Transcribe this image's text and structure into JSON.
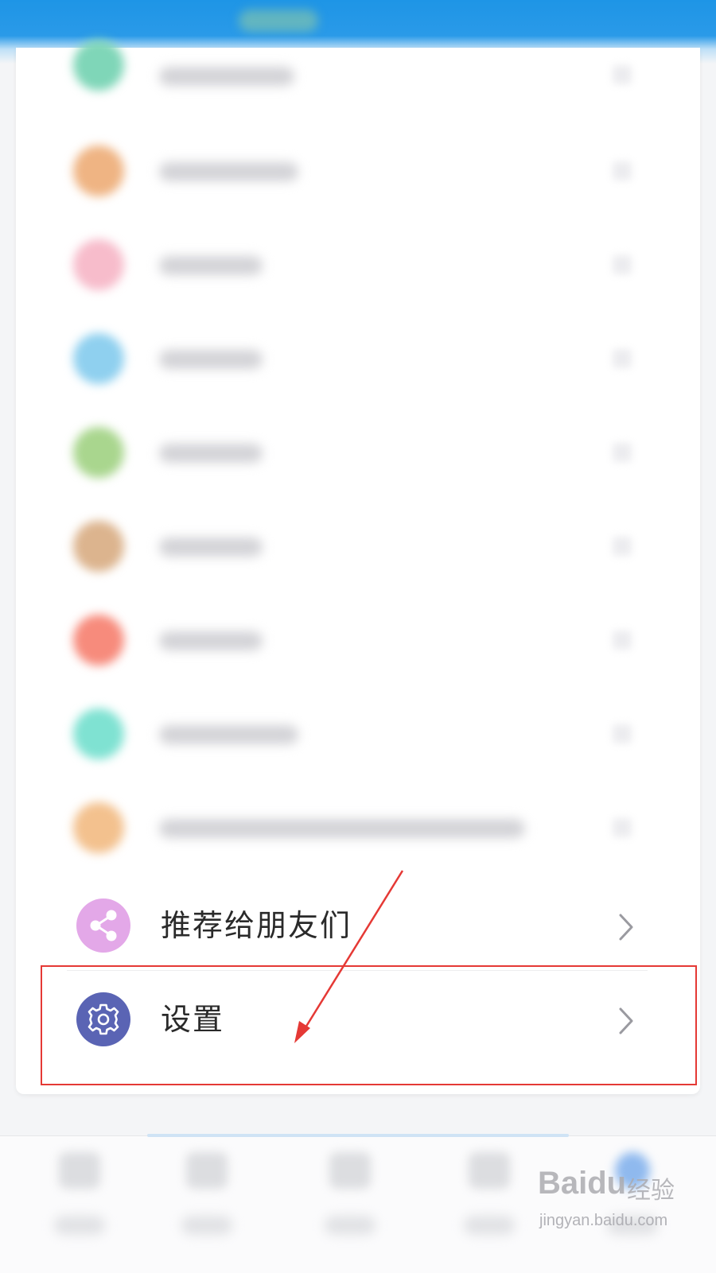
{
  "menu": {
    "blurred_items": [
      {
        "icon_color": "#7fd6b8"
      },
      {
        "icon_color": "#efb483"
      },
      {
        "icon_color": "#f7bccb"
      },
      {
        "icon_color": "#8fd0ef"
      },
      {
        "icon_color": "#a9d68e"
      },
      {
        "icon_color": "#dcb48e"
      },
      {
        "icon_color": "#f78b7c"
      },
      {
        "icon_color": "#7fe2d2"
      },
      {
        "icon_color": "#f3c18e"
      }
    ],
    "items": [
      {
        "label": "推荐给朋友们",
        "icon": "share-icon",
        "icon_color": "#e3a8e8"
      },
      {
        "label": "设置",
        "icon": "gear-icon",
        "icon_color": "#5a64b4"
      }
    ]
  },
  "annotation": {
    "color": "#e53935",
    "target": "设置"
  },
  "bottom_nav": {
    "item_count": 5,
    "active_index": 4
  },
  "watermark": {
    "brand": "Baidu",
    "cn": "经验",
    "url": "jingyan.baidu.com"
  }
}
